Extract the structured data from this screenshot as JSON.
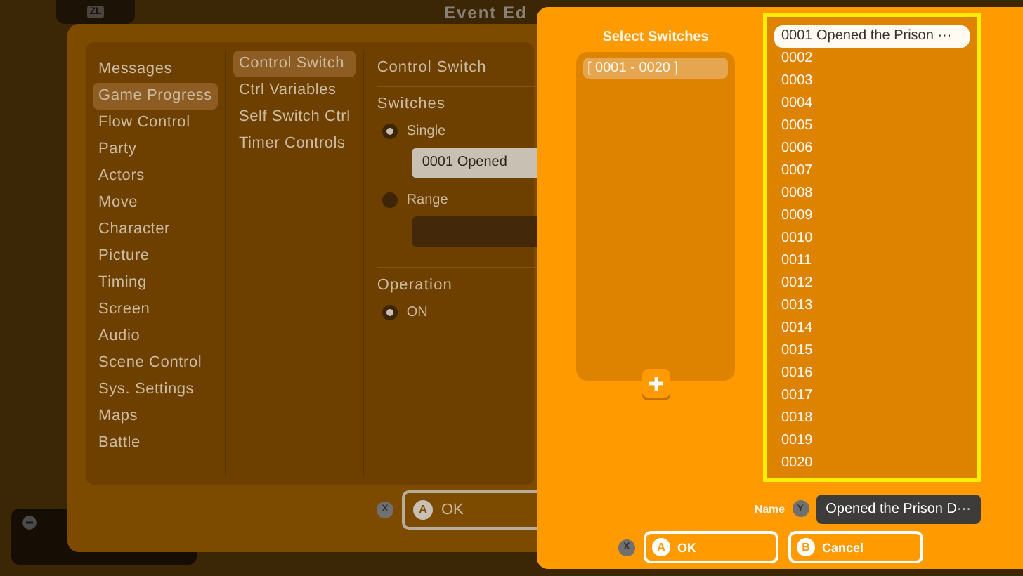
{
  "background_window": {
    "title": "Event Ed",
    "zl_key": "ZL"
  },
  "categories": [
    {
      "label": "Messages",
      "selected": false
    },
    {
      "label": "Game Progress",
      "selected": true
    },
    {
      "label": "Flow Control",
      "selected": false
    },
    {
      "label": "Party",
      "selected": false
    },
    {
      "label": "Actors",
      "selected": false
    },
    {
      "label": "Move",
      "selected": false
    },
    {
      "label": "Character",
      "selected": false
    },
    {
      "label": "Picture",
      "selected": false
    },
    {
      "label": "Timing",
      "selected": false
    },
    {
      "label": "Screen",
      "selected": false
    },
    {
      "label": "Audio",
      "selected": false
    },
    {
      "label": "Scene Control",
      "selected": false
    },
    {
      "label": "Sys. Settings",
      "selected": false
    },
    {
      "label": "Maps",
      "selected": false
    },
    {
      "label": "Battle",
      "selected": false
    }
  ],
  "commands": [
    {
      "label": "Control Switch",
      "selected": true
    },
    {
      "label": "Ctrl Variables",
      "selected": false
    },
    {
      "label": "Self Switch Ctrl",
      "selected": false
    },
    {
      "label": "Timer Controls",
      "selected": false
    }
  ],
  "settings": {
    "header": "Control Switch",
    "switches_label": "Switches",
    "modes": [
      {
        "label": "Single",
        "selected": true
      },
      {
        "label": "Range",
        "selected": false
      }
    ],
    "single_value": "0001 Opened",
    "operation_label": "Operation",
    "operations": [
      {
        "label": "ON",
        "selected": true
      }
    ]
  },
  "footer": {
    "close_key": "X",
    "ok_key": "A",
    "ok_label": "OK"
  },
  "dialog": {
    "title": "Select Switches",
    "groups": [
      {
        "label": "[ 0001 - 0020 ]",
        "selected": true
      }
    ],
    "switches": [
      {
        "label": "0001 Opened the Prison ···",
        "selected": true
      },
      {
        "label": "0002",
        "selected": false
      },
      {
        "label": "0003",
        "selected": false
      },
      {
        "label": "0004",
        "selected": false
      },
      {
        "label": "0005",
        "selected": false
      },
      {
        "label": "0006",
        "selected": false
      },
      {
        "label": "0007",
        "selected": false
      },
      {
        "label": "0008",
        "selected": false
      },
      {
        "label": "0009",
        "selected": false
      },
      {
        "label": "0010",
        "selected": false
      },
      {
        "label": "0011",
        "selected": false
      },
      {
        "label": "0012",
        "selected": false
      },
      {
        "label": "0013",
        "selected": false
      },
      {
        "label": "0014",
        "selected": false
      },
      {
        "label": "0015",
        "selected": false
      },
      {
        "label": "0016",
        "selected": false
      },
      {
        "label": "0017",
        "selected": false
      },
      {
        "label": "0018",
        "selected": false
      },
      {
        "label": "0019",
        "selected": false
      },
      {
        "label": "0020",
        "selected": false
      }
    ],
    "name_label": "Name",
    "name_key": "Y",
    "name_value": "Opened the Prison D···",
    "close_key": "X",
    "buttons": [
      {
        "key": "A",
        "label": "OK"
      },
      {
        "key": "B",
        "label": "Cancel"
      }
    ]
  }
}
